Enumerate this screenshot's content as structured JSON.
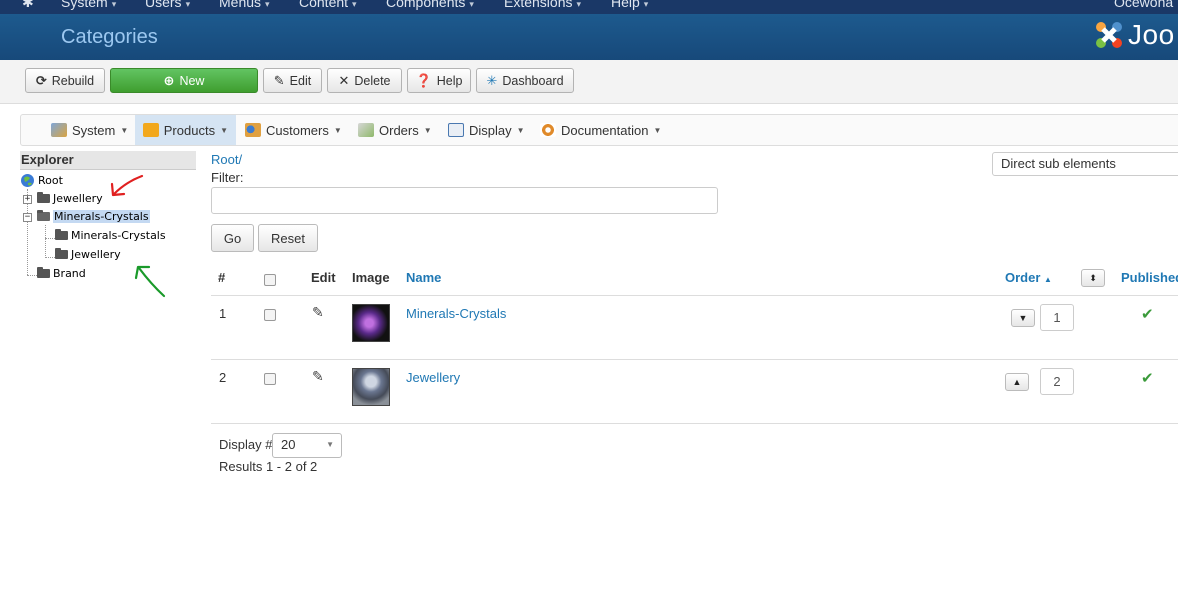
{
  "topnav": {
    "items": [
      {
        "label": "System"
      },
      {
        "label": "Users"
      },
      {
        "label": "Menus"
      },
      {
        "label": "Content"
      },
      {
        "label": "Components"
      },
      {
        "label": "Extensions"
      },
      {
        "label": "Help"
      }
    ],
    "user_name": "Ocewona"
  },
  "header": {
    "title": "Categories",
    "logo_text": "Joo"
  },
  "toolbar": {
    "rebuild": "Rebuild",
    "new": "New",
    "edit": "Edit",
    "delete": "Delete",
    "help": "Help",
    "dashboard": "Dashboard"
  },
  "menubar": {
    "items": [
      {
        "label": "System",
        "icon": "tools-icon"
      },
      {
        "label": "Products",
        "icon": "products-icon"
      },
      {
        "label": "Customers",
        "icon": "customers-icon"
      },
      {
        "label": "Orders",
        "icon": "orders-icon"
      },
      {
        "label": "Display",
        "icon": "display-icon"
      },
      {
        "label": "Documentation",
        "icon": "documentation-icon"
      }
    ]
  },
  "explorer": {
    "title": "Explorer",
    "root": "Root",
    "nodes": {
      "jewellery": "Jewellery",
      "minerals": "Minerals-Crystals",
      "minerals_child1": "Minerals-Crystals",
      "minerals_child2": "Jewellery",
      "brand": "Brand"
    }
  },
  "content": {
    "breadcrumb": "Root/",
    "filter_label": "Filter:",
    "filter_value": "",
    "go": "Go",
    "reset": "Reset",
    "scope": "Direct sub elements"
  },
  "table": {
    "headers": {
      "num": "#",
      "edit": "Edit",
      "image": "Image",
      "name": "Name",
      "order": "Order",
      "published": "Published"
    },
    "rows": [
      {
        "num": "1",
        "name": "Minerals-Crystals",
        "order": "1",
        "order_icon": "chevron-down-icon",
        "published": "✔"
      },
      {
        "num": "2",
        "name": "Jewellery",
        "order": "2",
        "order_icon": "chevron-up-icon",
        "published": "✔"
      }
    ]
  },
  "footer": {
    "display_label": "Display #",
    "limit": "20",
    "results": "Results 1 - 2 of 2"
  },
  "colors": {
    "header_bg": "#1d5a8e",
    "link": "#1f78b4",
    "new_button": "#4cae3c",
    "published_check": "#3a9a3a",
    "annotation_red": "#e02020",
    "annotation_green": "#1a9a2a"
  }
}
